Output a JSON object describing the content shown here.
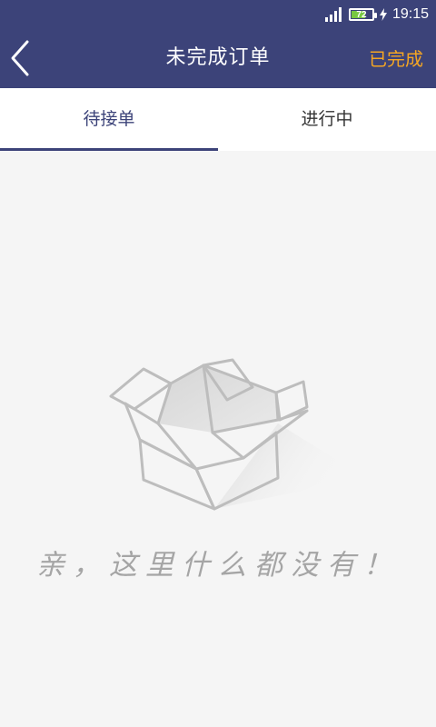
{
  "status": {
    "battery": "72",
    "time": "19:15"
  },
  "nav": {
    "title": "未完成订单",
    "right_action": "已完成"
  },
  "tabs": [
    {
      "label": "待接单",
      "active": true
    },
    {
      "label": "进行中",
      "active": false
    }
  ],
  "empty": {
    "message": "亲，这里什么都没有！"
  },
  "colors": {
    "primary": "#3c4379",
    "accent": "#f5a623",
    "battery": "#78c841"
  }
}
